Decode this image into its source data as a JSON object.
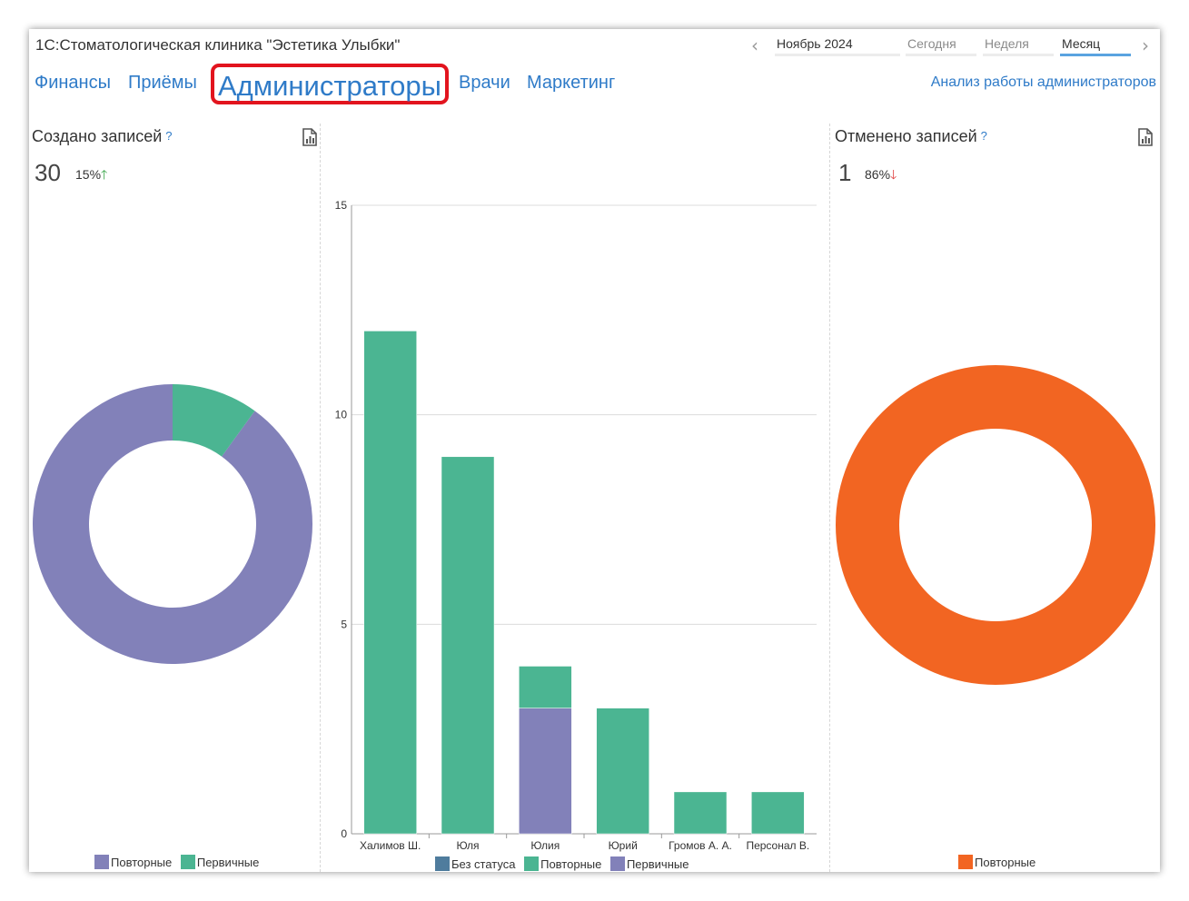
{
  "app": {
    "title": "1С:Стоматологическая клиника \"Эстетика Улыбки\""
  },
  "period": {
    "month_label": "Ноябрь 2024",
    "today": "Сегодня",
    "week": "Неделя",
    "month": "Месяц",
    "active": "Месяц"
  },
  "tabs": [
    {
      "label": "Финансы"
    },
    {
      "label": "Приёмы"
    },
    {
      "label": "Администраторы",
      "active": true
    },
    {
      "label": "Врачи"
    },
    {
      "label": "Маркетинг"
    }
  ],
  "analysis_link": "Анализ работы администраторов",
  "created": {
    "title": "Создано записей",
    "help": "?",
    "value": "30",
    "change": "15%",
    "trend": "up"
  },
  "cancelled": {
    "title": "Отменено записей",
    "help": "?",
    "value": "1",
    "change": "86%",
    "trend": "down"
  },
  "colors": {
    "repeat": "#8281b9",
    "primary": "#4bb592",
    "no_status": "#4f7c9d",
    "cancel_repeat": "#f26522",
    "link": "#2f7bc8",
    "highlight": "#e2141e"
  },
  "chart_data": [
    {
      "type": "pie",
      "donut": true,
      "labels": [
        "Повторные",
        "Первичные"
      ],
      "values": [
        27,
        3
      ],
      "legend": [
        "Повторные",
        "Первичные"
      ],
      "legend_position": "bottom"
    },
    {
      "type": "bar",
      "stacked": true,
      "categories": [
        "Халимов Ш.",
        "Юля",
        "Юлия",
        "Юрий",
        "Громов А. А.",
        "Персонал В."
      ],
      "series": [
        {
          "name": "Без статуса",
          "values": [
            0,
            0,
            0,
            0,
            0,
            0
          ]
        },
        {
          "name": "Первичные",
          "values": [
            0,
            0,
            3,
            0,
            0,
            0
          ]
        },
        {
          "name": "Повторные",
          "values": [
            12,
            9,
            1,
            3,
            1,
            1
          ]
        }
      ],
      "legend": [
        "Без статуса",
        "Повторные",
        "Первичные"
      ],
      "yticks": [
        "0",
        "5",
        "10",
        "15"
      ],
      "ylim": [
        0,
        15
      ],
      "grid": true,
      "legend_position": "bottom"
    },
    {
      "type": "pie",
      "donut": true,
      "labels": [
        "Повторные"
      ],
      "values": [
        1
      ],
      "legend": [
        "Повторные"
      ],
      "legend_position": "bottom"
    }
  ]
}
